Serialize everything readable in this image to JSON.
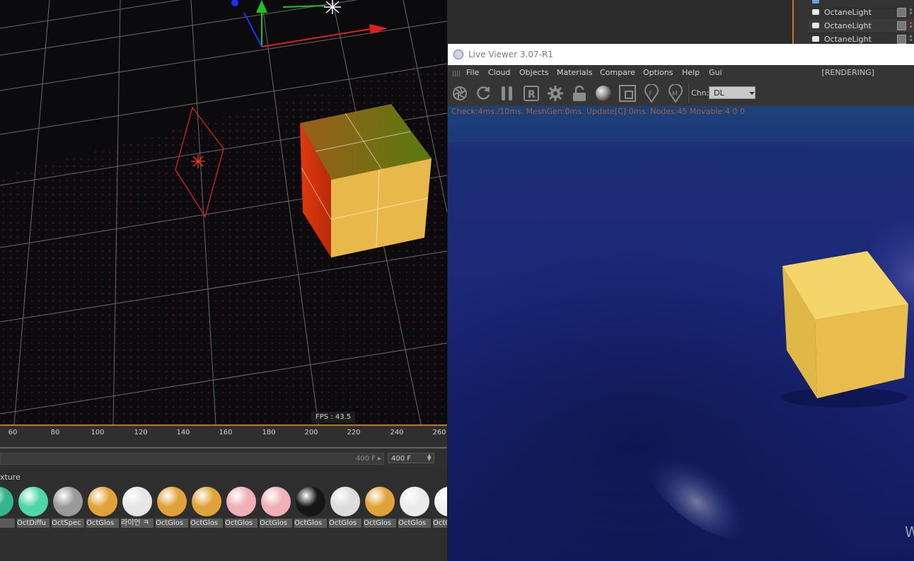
{
  "viewport": {
    "fps_label": "FPS : 43.5"
  },
  "object_manager": {
    "items": [
      {
        "label": "OctaneLight"
      },
      {
        "label": "OctaneLight"
      },
      {
        "label": "OctaneLight"
      }
    ]
  },
  "timeline": {
    "ticks": [
      "60",
      "80",
      "100",
      "120",
      "140",
      "160",
      "180",
      "200",
      "220",
      "240",
      "260"
    ],
    "slider_end": "400 F",
    "end_frame": "400 F"
  },
  "material_manager": {
    "header_label": "xture",
    "materials": [
      {
        "name": "ne",
        "color": "#34b58c"
      },
      {
        "name": "OctDiffu",
        "color": "#4fd6a9"
      },
      {
        "name": "OctSpec",
        "color": "#9a9a9a"
      },
      {
        "name": "OctGlos",
        "color": "#e0a33a"
      },
      {
        "name": "라이언 ㅋ",
        "color": "#e6e6e6"
      },
      {
        "name": "OctGlos",
        "color": "#e0a33a"
      },
      {
        "name": "OctGlos",
        "color": "#e0a33a"
      },
      {
        "name": "OctGlos",
        "color": "#f0b0b8"
      },
      {
        "name": "OctGlos",
        "color": "#f0b0b8"
      },
      {
        "name": "OctGlos",
        "color": "#161616"
      },
      {
        "name": "OctGlos",
        "color": "#dcdcdc"
      },
      {
        "name": "OctGlos",
        "color": "#e0a33a"
      },
      {
        "name": "OctGlos",
        "color": "#ebebeb"
      },
      {
        "name": "OctG",
        "color": "#f0f0f0"
      }
    ]
  },
  "live_viewer": {
    "title": "Live Viewer 3.07-R1",
    "menu": [
      "File",
      "Cloud",
      "Objects",
      "Materials",
      "Compare",
      "Options",
      "Help",
      "Gui"
    ],
    "status": "[RENDERING]",
    "channel_label": "Chn:",
    "channel_value": "DL",
    "info_line": "Check:4ms./10ms. MeshGen:0ms. Update[C]:0ms. Nodes:45 Movable:4   0  0",
    "toolbar_icons": [
      "aperture-icon",
      "refresh-icon",
      "pause-icon",
      "r-icon",
      "gear-icon",
      "lock-icon",
      "sphere-icon",
      "region-icon",
      "pin-f-icon",
      "pin-m-icon"
    ],
    "watermark": "W"
  },
  "colors": {
    "accent_orange": "#c4772a",
    "cube_yellow": "#e8b84a",
    "render_blue": "#1b2a78",
    "info_orange": "#b05a2c"
  }
}
